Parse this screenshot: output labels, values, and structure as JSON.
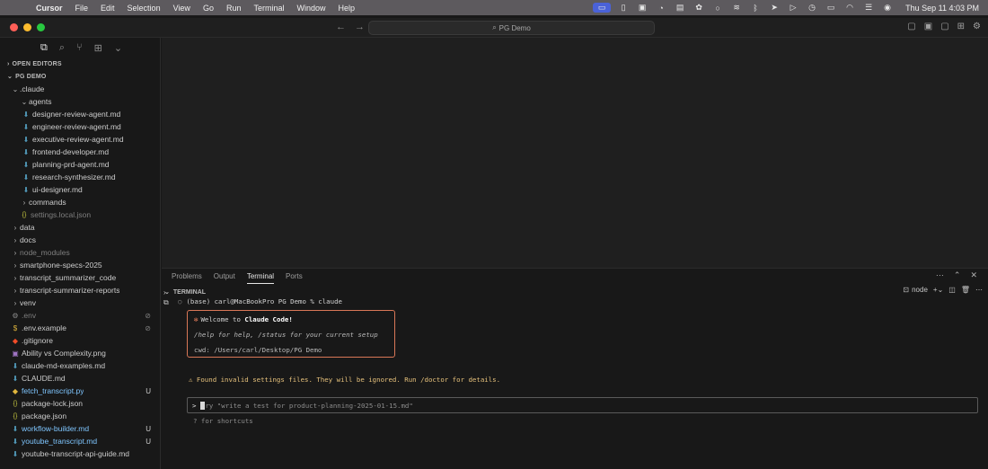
{
  "menubar": {
    "app_name": "Cursor",
    "items": [
      "File",
      "Edit",
      "Selection",
      "View",
      "Go",
      "Run",
      "Terminal",
      "Window",
      "Help"
    ],
    "clock": "Thu Sep 11  4:03 PM"
  },
  "titlebar": {
    "search_text": "PG Demo"
  },
  "sidebar": {
    "open_editors_label": "OPEN EDITORS",
    "project_label": "PG DEMO",
    "tree": [
      {
        "name": ".claude",
        "type": "folder",
        "open": true,
        "depth": 0
      },
      {
        "name": "agents",
        "type": "folder",
        "open": true,
        "depth": 1
      },
      {
        "name": "designer-review-agent.md",
        "type": "md",
        "depth": 2
      },
      {
        "name": "engineer-review-agent.md",
        "type": "md",
        "depth": 2
      },
      {
        "name": "executive-review-agent.md",
        "type": "md",
        "depth": 2
      },
      {
        "name": "frontend-developer.md",
        "type": "md",
        "depth": 2
      },
      {
        "name": "planning-prd-agent.md",
        "type": "md",
        "depth": 2
      },
      {
        "name": "research-synthesizer.md",
        "type": "md",
        "depth": 2
      },
      {
        "name": "ui-designer.md",
        "type": "md",
        "depth": 2
      },
      {
        "name": "commands",
        "type": "folder",
        "open": false,
        "depth": 1
      },
      {
        "name": "settings.local.json",
        "type": "json",
        "depth": 1,
        "dim": true
      },
      {
        "name": "data",
        "type": "folder",
        "open": false,
        "depth": 0
      },
      {
        "name": "docs",
        "type": "folder",
        "open": false,
        "depth": 0
      },
      {
        "name": "node_modules",
        "type": "folder",
        "open": false,
        "depth": 0,
        "dim": true
      },
      {
        "name": "smartphone-specs-2025",
        "type": "folder",
        "open": false,
        "depth": 0
      },
      {
        "name": "transcript_summarizer_code",
        "type": "folder",
        "open": false,
        "depth": 0
      },
      {
        "name": "transcript-summarizer-reports",
        "type": "folder",
        "open": false,
        "depth": 0
      },
      {
        "name": "venv",
        "type": "folder",
        "open": false,
        "depth": 0
      },
      {
        "name": ".env",
        "type": "gear",
        "depth": 0,
        "dim": true,
        "badge": "⊘"
      },
      {
        "name": ".env.example",
        "type": "env",
        "depth": 0,
        "badge": "⊘"
      },
      {
        "name": ".gitignore",
        "type": "git",
        "depth": 0
      },
      {
        "name": "Ability vs Complexity.png",
        "type": "img",
        "depth": 0
      },
      {
        "name": "claude-md-examples.md",
        "type": "md",
        "depth": 0
      },
      {
        "name": "CLAUDE.md",
        "type": "md",
        "depth": 0
      },
      {
        "name": "fetch_transcript.py",
        "type": "py",
        "depth": 0,
        "mod": true,
        "badge": "U"
      },
      {
        "name": "package-lock.json",
        "type": "json",
        "depth": 0
      },
      {
        "name": "package.json",
        "type": "json",
        "depth": 0
      },
      {
        "name": "workflow-builder.md",
        "type": "md",
        "depth": 0,
        "mod": true,
        "badge": "U"
      },
      {
        "name": "youtube_transcript.md",
        "type": "md",
        "depth": 0,
        "mod": true,
        "badge": "U"
      },
      {
        "name": "youtube-transcript-api-guide.md",
        "type": "md",
        "depth": 0
      }
    ]
  },
  "panel": {
    "tabs": [
      "Problems",
      "Output",
      "Terminal",
      "Ports"
    ],
    "active_tab": "Terminal",
    "terminal_label": "TERMINAL",
    "shell_name": "node"
  },
  "terminal": {
    "prompt": "(base) carl@MacBookPro PG Demo % claude",
    "welcome_prefix": "Welcome to ",
    "welcome_product": "Claude Code!",
    "help_line": "/help for help, /status for your current setup",
    "cwd_line": "cwd: /Users/carl/Desktop/PG Demo",
    "warning": "⚠ Found invalid settings files. They will be ignored. Run /doctor for details.",
    "input_placeholder": "ry \"write a test for product-planning-2025-01-15.md\"",
    "shortcuts_hint": "? for shortcuts"
  },
  "colors": {
    "accent_orange": "#d97757",
    "warning_yellow": "#e5c07b",
    "modified_blue": "#7fc6ff"
  }
}
